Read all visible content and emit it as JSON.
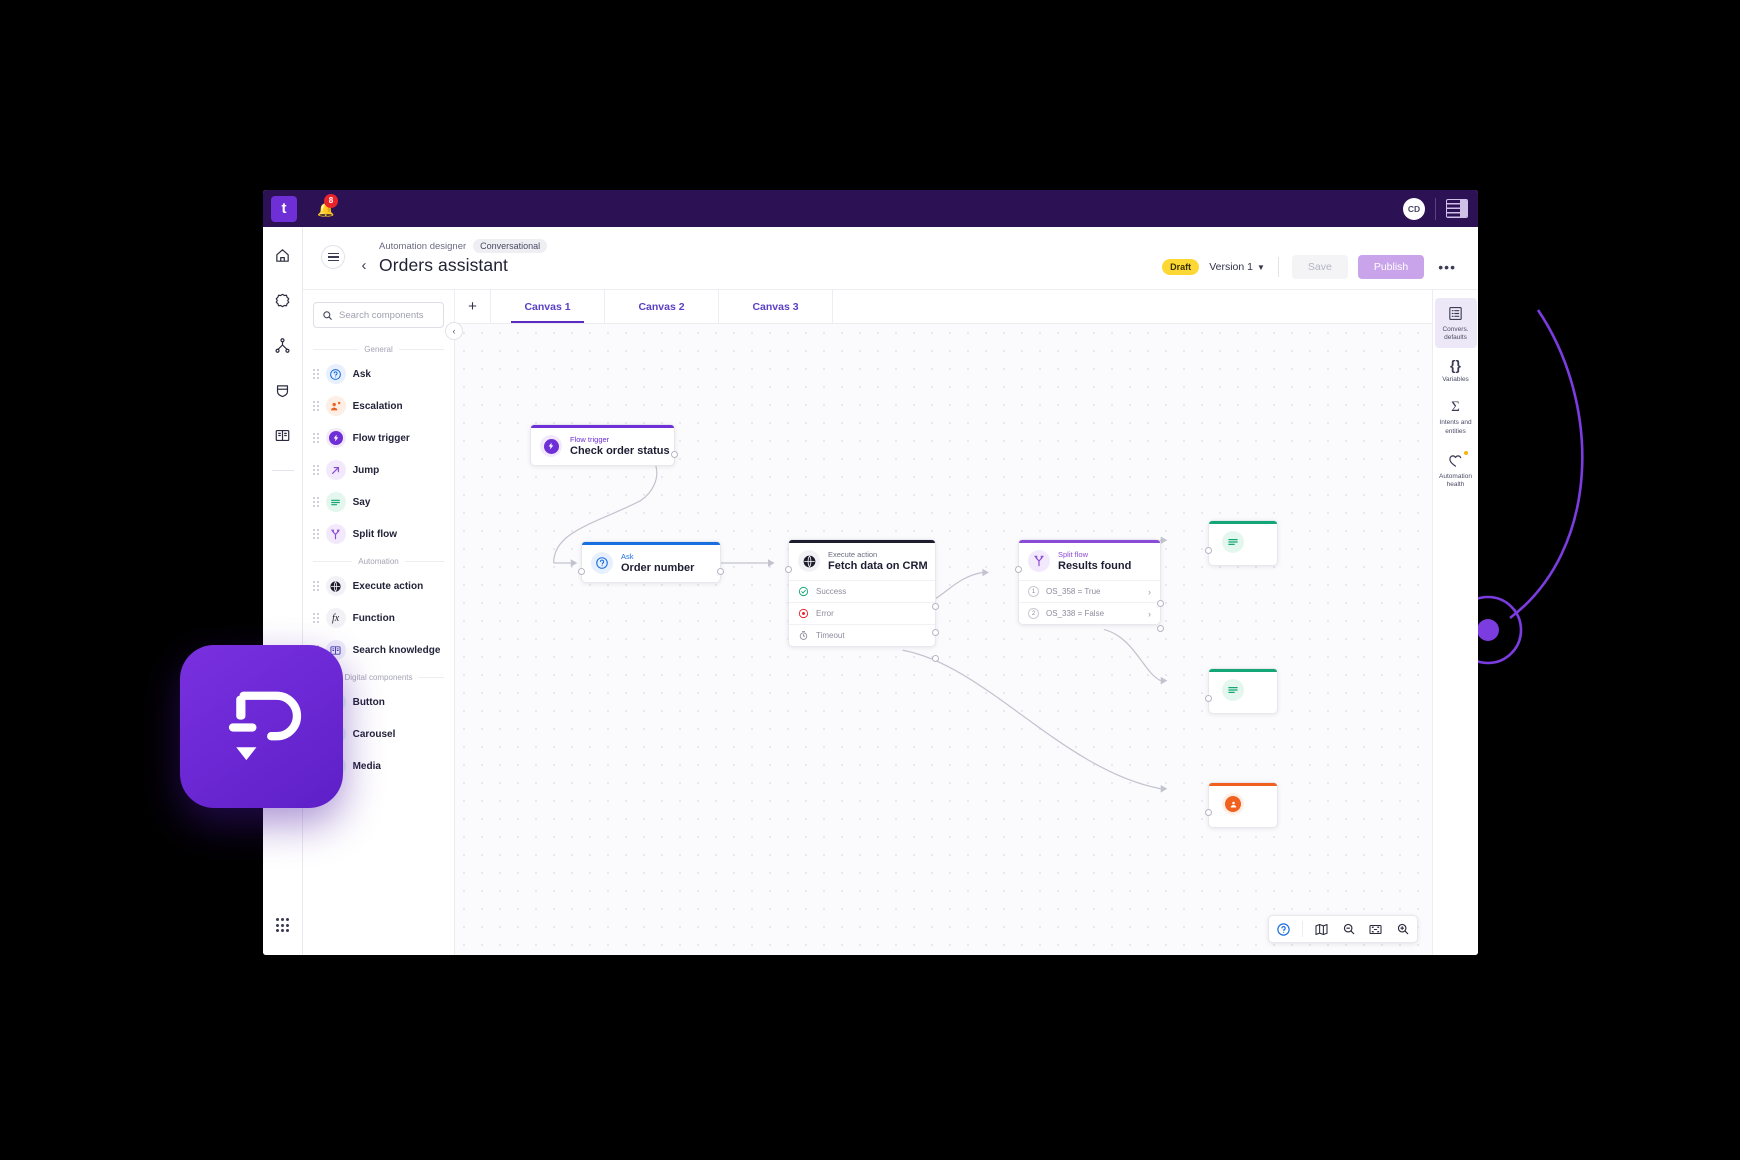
{
  "topbar": {
    "brand_letter": "t",
    "notification_count": "8",
    "bell_icon": "bell-icon",
    "avatar_initials": "CD",
    "panel_icon": "side-panel-icon"
  },
  "rail": {
    "items": [
      {
        "icon": "home-icon",
        "name": "home"
      },
      {
        "icon": "flower-settings-icon",
        "name": "settings"
      },
      {
        "icon": "flow-hierarchy-icon",
        "name": "automations"
      },
      {
        "icon": "shield-icon",
        "name": "security"
      },
      {
        "icon": "book-icon",
        "name": "knowledge"
      }
    ],
    "apps_icon": "grid-apps-icon"
  },
  "header": {
    "menu_icon": "hamburger-icon",
    "back_icon": "chevron-left-icon",
    "breadcrumb_root": "Automation designer",
    "breadcrumb_chip": "Conversational",
    "title": "Orders assistant",
    "status_badge": "Draft",
    "version_label": "Version 1",
    "version_caret": "⌵",
    "save_label": "Save",
    "publish_label": "Publish",
    "more_label": "•••"
  },
  "palette": {
    "search_placeholder": "Search components",
    "search_value": "",
    "search_icon": "search-icon",
    "collapse_icon": "chevron-left-icon",
    "sections": [
      {
        "label": "General",
        "items": [
          {
            "label": "Ask",
            "icon": "question-circle-icon",
            "color": "#1a6fe0",
            "bg": "#e8f0fd"
          },
          {
            "label": "Escalation",
            "icon": "agent-handoff-icon",
            "color": "#f0601f",
            "bg": "#fdeee6"
          },
          {
            "label": "Flow trigger",
            "icon": "bolt-icon",
            "color": "#ffffff",
            "bg": "#f3e9fd"
          },
          {
            "label": "Jump",
            "icon": "arrow-up-right-icon",
            "color": "#8a4bd6",
            "bg": "#f3e9fd"
          },
          {
            "label": "Say",
            "icon": "lines-icon",
            "color": "#12a775",
            "bg": "#e3f7ef"
          },
          {
            "label": "Split flow",
            "icon": "split-branch-icon",
            "color": "#8a4bd6",
            "bg": "#f3e9fd"
          }
        ]
      },
      {
        "label": "Automation",
        "items": [
          {
            "label": "Execute action",
            "icon": "globe-icon",
            "color": "#1d1d2e",
            "bg": "#f2f2f6"
          },
          {
            "label": "Function",
            "icon": "fx-icon",
            "color": "#1d1d2e",
            "bg": "#f2f2f6"
          },
          {
            "label": "Search knowledge",
            "icon": "book-open-icon",
            "color": "#4a3fb5",
            "bg": "#eeecfa"
          }
        ]
      },
      {
        "label": "Digital components",
        "items": [
          {
            "label": "Button",
            "icon": "cursor-click-icon",
            "color": "#12a775",
            "bg": "#e3f7ef"
          },
          {
            "label": "Carousel",
            "icon": "carousel-icon",
            "color": "#12a775",
            "bg": "#e3f7ef"
          },
          {
            "label": "Media",
            "icon": "media-image-icon",
            "color": "#12a775",
            "bg": "#e3f7ef"
          }
        ]
      }
    ]
  },
  "canvas": {
    "add_tab_icon": "plus-icon",
    "tabs": [
      {
        "label": "Canvas 1",
        "active": true
      },
      {
        "label": "Canvas 2",
        "active": false
      },
      {
        "label": "Canvas 3",
        "active": false
      }
    ],
    "nodes": [
      {
        "kind": "Flow trigger",
        "title": "Check order status",
        "accent": "#6f2fd6",
        "icon": "bolt-icon"
      },
      {
        "kind": "Ask",
        "title": "Order number",
        "accent": "#1a6fe0",
        "icon": "question-circle-icon"
      },
      {
        "kind": "Execute action",
        "title": "Fetch data on CRM",
        "accent": "#1d1d2e",
        "icon": "globe-icon",
        "rows": [
          {
            "label": "Success",
            "icon": "check-circle-icon",
            "color": "#12a775"
          },
          {
            "label": "Error",
            "icon": "error-circle-icon",
            "color": "#e8242a"
          },
          {
            "label": "Timeout",
            "icon": "stopwatch-icon",
            "color": "#8c8c9e"
          }
        ]
      },
      {
        "kind": "Split flow",
        "title": "Results found",
        "accent": "#8a4bd6",
        "icon": "split-branch-icon",
        "rows": [
          {
            "num": "1",
            "label": "OS_358 = True"
          },
          {
            "num": "2",
            "label": "OS_338 = False"
          }
        ]
      }
    ],
    "edge_nodes": [
      {
        "accent": "#12a775",
        "icon": "lines-icon",
        "bg": "#e3f7ef",
        "color": "#12a775"
      },
      {
        "accent": "#12a775",
        "icon": "lines-icon",
        "bg": "#e3f7ef",
        "color": "#12a775"
      },
      {
        "accent": "#f0601f",
        "icon": "escalation-solid-icon",
        "bg": "#f0601f",
        "color": "#ffffff"
      }
    ],
    "tools": [
      {
        "icon": "help-circle-icon",
        "name": "help"
      },
      {
        "icon": "minimap-icon",
        "name": "minimap"
      },
      {
        "icon": "zoom-out-icon",
        "name": "zoom-out"
      },
      {
        "icon": "fit-screen-icon",
        "name": "fit-to-screen"
      },
      {
        "icon": "zoom-in-icon",
        "name": "zoom-in"
      }
    ]
  },
  "right_panel": {
    "items": [
      {
        "label": "Convers. defaults",
        "icon": "conversation-defaults-icon",
        "active": true,
        "dot": false
      },
      {
        "label": "Variables",
        "icon": "braces-icon",
        "active": false,
        "dot": false
      },
      {
        "label": "Intents and entities",
        "icon": "sigma-icon",
        "active": false,
        "dot": false
      },
      {
        "label": "Automation health",
        "icon": "heart-pulse-icon",
        "active": false,
        "dot": true
      }
    ]
  },
  "logo": {
    "name": "app-logo",
    "icon": "chatbot-logo-icon"
  },
  "colors": {
    "brand_purple": "#6f2fd6",
    "topbar": "#2d1155",
    "accent_blue": "#1a6fe0",
    "accent_green": "#12a775",
    "accent_orange": "#f0601f",
    "draft_yellow": "#fdd835"
  }
}
